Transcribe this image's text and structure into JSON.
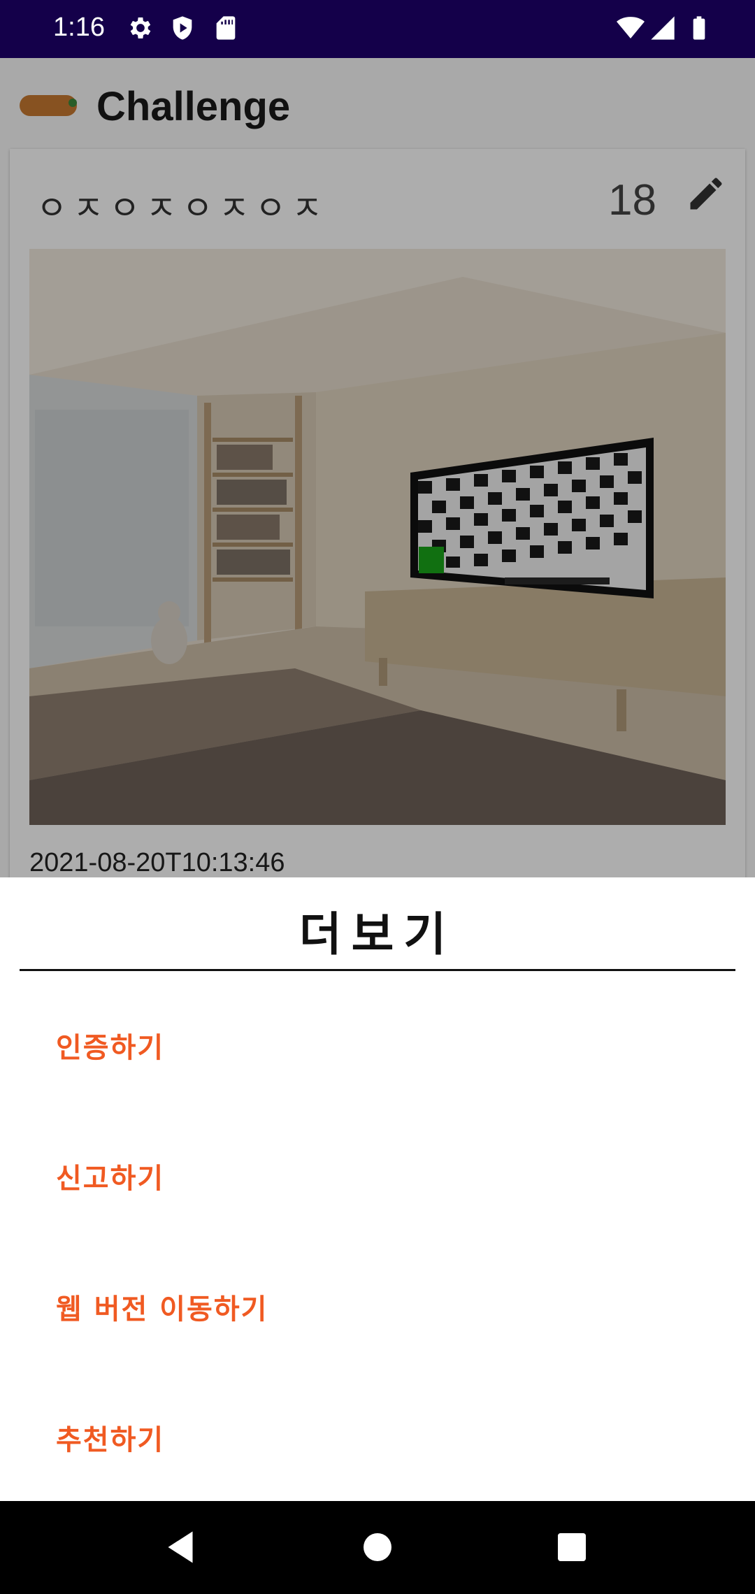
{
  "status_bar": {
    "time": "1:16",
    "left_icons": [
      "gear-icon",
      "shield-play-icon",
      "sd-card-icon"
    ],
    "right_icons": [
      "wifi-icon",
      "signal-icon",
      "battery-icon"
    ],
    "background": "#14004a"
  },
  "app": {
    "title": "Challenge",
    "logo_icon": "carrot-logo"
  },
  "post": {
    "title": "ㅇㅈㅇㅈㅇㅈㅇㅈ",
    "count": "18",
    "edit_icon": "pencil-icon",
    "date": "2021-08-20T10:13:46"
  },
  "sheet": {
    "title": "더보기",
    "items": [
      {
        "label": "인증하기"
      },
      {
        "label": "신고하기"
      },
      {
        "label": "웹 버전 이동하기"
      },
      {
        "label": "추천하기"
      }
    ],
    "accent_color": "#f05a22"
  },
  "nav": {
    "icons": [
      "back-icon",
      "home-icon",
      "recents-icon"
    ]
  }
}
